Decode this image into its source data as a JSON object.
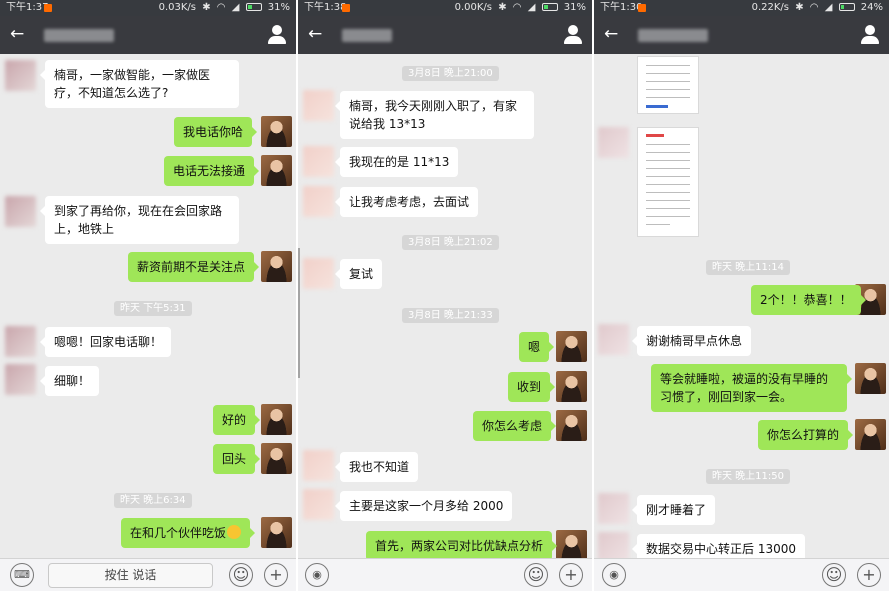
{
  "status_bars": [
    {
      "time": "下午1:37",
      "speed": "0.03K/s",
      "battery": "31%"
    },
    {
      "time": "下午1:38",
      "speed": "0.00K/s",
      "battery": "31%"
    },
    {
      "time": "下午1:30",
      "speed": "0.22K/s",
      "battery": "24%"
    }
  ],
  "input_bar": {
    "hold_to_talk": "按住 说话"
  },
  "panel1": {
    "messages": [
      "楠哥，一家做智能，一家做医疗，不知道怎么选了?",
      "我电话你哈",
      "电话无法接通",
      "到家了再给你，现在在会回家路上，地铁上",
      "薪资前期不是关注点",
      "昨天 下午5:31",
      "嗯嗯！回家电话聊！",
      "细聊！",
      "好的",
      "回头",
      "昨天 晚上6:34",
      "在和几个伙伴吃饭"
    ]
  },
  "panel2": {
    "messages": [
      "3月8日 晚上21:00",
      "楠哥，我今天刚刚入职了，有家说给我 13*13",
      "我现在的是 11*13",
      "让我考虑考虑，去面试",
      "3月8日 晚上21:02",
      "复试",
      "3月8日 晚上21:33",
      "嗯",
      "收到",
      "你怎么考虑",
      "我也不知道",
      "主要是这家一个月多给 2000",
      "首先，两家公司对比优缺点分析"
    ]
  },
  "panel3": {
    "messages": [
      "昨天 晚上11:14",
      "2个！！恭喜！！",
      "谢谢楠哥早点休息",
      "等会就睡啦，被逼的没有早睡的习惯了，刚回到家一会。",
      "你怎么打算的",
      "昨天 晚上11:50",
      "刚才睡着了",
      "数据交易中心转正后 13000"
    ]
  }
}
